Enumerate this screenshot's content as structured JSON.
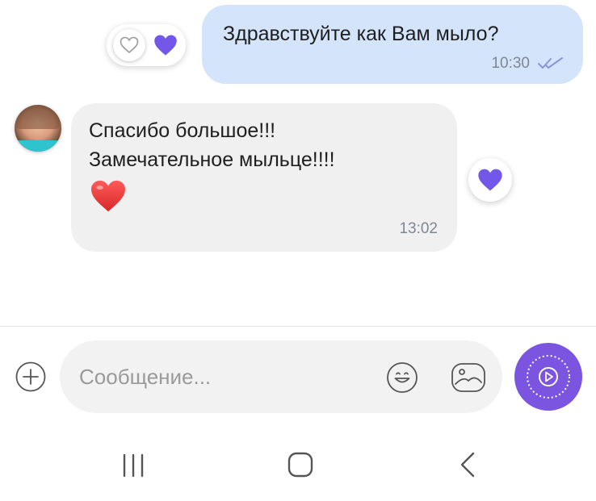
{
  "colors": {
    "outgoing_bubble": "#d4e4fb",
    "incoming_bubble": "#f0f0f0",
    "accent_purple": "#7b54df",
    "reaction_heart": "#7357e8",
    "love_heart": "#e53b3b"
  },
  "messages": [
    {
      "direction": "outgoing",
      "text": "Здравствуйте как Вам мыло?",
      "time": "10:30",
      "status_icon": "double-check-icon",
      "reactions": [
        "heart-outline-icon",
        "heart-filled-icon"
      ]
    },
    {
      "direction": "incoming",
      "lines": [
        "Спасибо большое!!!",
        "Замечательное мыльце!!!!"
      ],
      "emoji": "red-heart-emoji",
      "time": "13:02",
      "reactions": [
        "heart-filled-icon"
      ]
    }
  ],
  "composer": {
    "placeholder": "Сообщение...",
    "attach_icon": "plus-circle-icon",
    "emoji_icon": "smiley-icon",
    "gallery_icon": "image-icon",
    "send_icon": "play-circle-icon"
  },
  "navbar": {
    "recents_icon": "recents-icon",
    "home_icon": "home-icon",
    "back_icon": "back-icon"
  }
}
